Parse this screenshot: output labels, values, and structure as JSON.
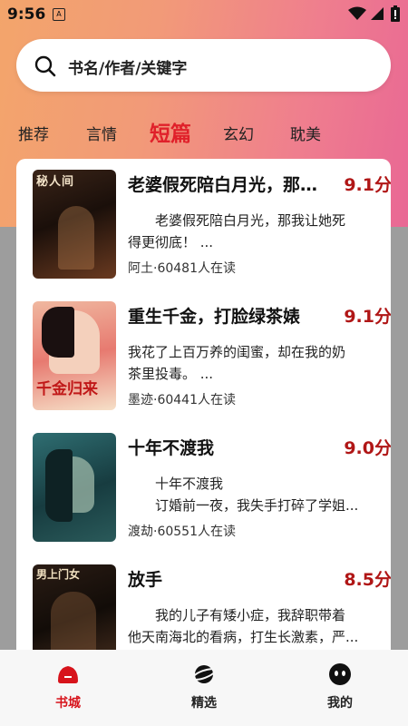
{
  "status_bar": {
    "time": "9:56",
    "notif": "A"
  },
  "search": {
    "placeholder": "书名/作者/关键字"
  },
  "tabs": [
    {
      "label": "推荐",
      "active": false
    },
    {
      "label": "言情",
      "active": false
    },
    {
      "label": "短篇",
      "active": true
    },
    {
      "label": "玄幻",
      "active": false
    },
    {
      "label": "耽美",
      "active": false
    }
  ],
  "books": [
    {
      "title": "老婆假死陪白月光，那我让她死得更彻底！",
      "score": "9.1分",
      "desc_line1": "　　老婆假死陪白月光，那我让她死",
      "desc_line2": "得更彻底！ ...",
      "meta": "阿土·60481人在读",
      "cover_colors": [
        "#2a1a14",
        "#7a4a2a"
      ],
      "cover_text": "秘人间"
    },
    {
      "title": "重生千金，打脸绿茶婊",
      "score": "9.1分",
      "desc_line1": "我花了上百万养的闺蜜，却在我的奶",
      "desc_line2": "茶里投毒。 ...",
      "meta": "墨迹·60441人在读",
      "cover_colors": [
        "#e86a6a",
        "#f3c0a0"
      ],
      "cover_text": "千金归来"
    },
    {
      "title": "十年不渡我",
      "score": "9.0分",
      "desc_line1": "　　十年不渡我",
      "desc_line2": "　　订婚前一夜，我失手打碎了学姐...",
      "meta": "渡劫·60551人在读",
      "cover_colors": [
        "#1a4a4e",
        "#2f7a7a"
      ],
      "cover_text": ""
    },
    {
      "title": "放手",
      "score": "8.5分",
      "desc_line1": "　　我的儿子有矮小症，我辞职带着",
      "desc_line2": "他天南海北的看病，打生长激素，严...",
      "meta": "",
      "cover_colors": [
        "#1e1612",
        "#5a3a26"
      ],
      "cover_text": "男上门女"
    }
  ],
  "bottom_nav": [
    {
      "label": "书城",
      "icon": "bookstore-icon",
      "active": true
    },
    {
      "label": "精选",
      "icon": "planet-icon",
      "active": false
    },
    {
      "label": "我的",
      "icon": "profile-face-icon",
      "active": false
    }
  ],
  "colors": {
    "accent": "#e0202a",
    "score": "#b01616"
  }
}
